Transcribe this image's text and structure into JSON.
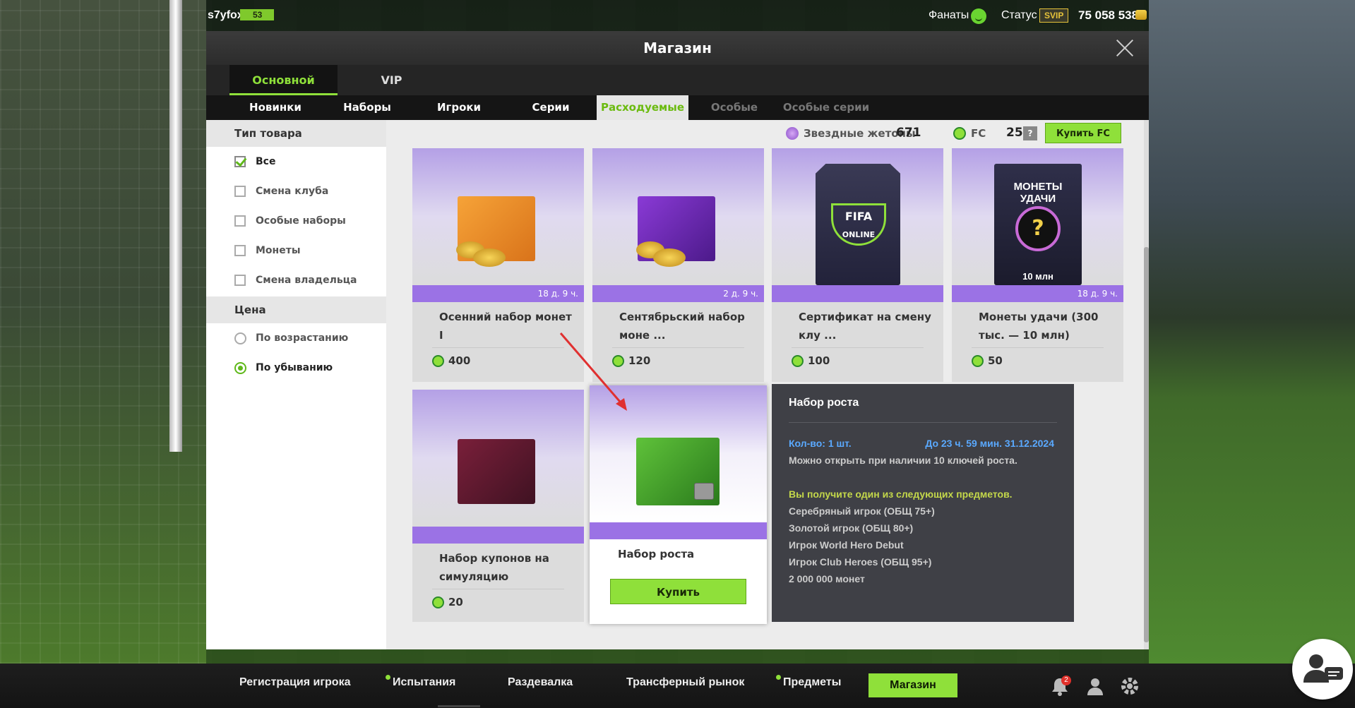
{
  "topbar": {
    "username": "s7yfox",
    "level": "53",
    "fans_label": "Фанаты",
    "status_label": "Статус",
    "status_badge": "SVIP",
    "money": "75 058 538"
  },
  "window": {
    "title": "Магазин"
  },
  "tabs": [
    {
      "label": "Основной",
      "active": true
    },
    {
      "label": "VIP",
      "active": false
    }
  ],
  "subtabs": [
    {
      "label": "Новинки"
    },
    {
      "label": "Наборы"
    },
    {
      "label": "Игроки"
    },
    {
      "label": "Серии"
    },
    {
      "label": "Расходуемые предметы"
    },
    {
      "label": "Особые товары"
    },
    {
      "label": "Особые серии"
    }
  ],
  "sidebar": {
    "type_heading": "Тип товара",
    "type_items": [
      {
        "label": "Все",
        "checked": true
      },
      {
        "label": "Смена клуба",
        "checked": false
      },
      {
        "label": "Особые наборы",
        "checked": false
      },
      {
        "label": "Монеты",
        "checked": false
      },
      {
        "label": "Смена владельца",
        "checked": false
      }
    ],
    "price_heading": "Цена",
    "price_items": [
      {
        "label": "По возрастанию",
        "selected": false
      },
      {
        "label": "По убыванию",
        "selected": true
      }
    ]
  },
  "currency": {
    "star_label": "Звездные жетоны",
    "star_value": "671",
    "fc_label": "FC",
    "fc_value": "25",
    "help": "?",
    "buy_fc": "Купить FC"
  },
  "cards": [
    {
      "title": "Осенний набор монет I",
      "timer": "18 д. 9 ч.",
      "price": "400"
    },
    {
      "title": "Сентябрьский набор моне ...",
      "timer": "2 д. 9 ч.",
      "price": "120"
    },
    {
      "title": "Сертификат на смену клу ...",
      "timer": "",
      "price": "100"
    },
    {
      "title": "Монеты удачи (300 тыс. — 10 млн)",
      "timer": "18 д. 9 ч.",
      "price": "50",
      "image_text": "МОНЕТЫ УДАЧИ",
      "image_sub": "10 млн"
    },
    {
      "title": "Набор купонов на симуляцию",
      "timer": "",
      "price": "20"
    },
    {
      "title": "Набор роста",
      "timer": "",
      "buy": "Купить"
    }
  ],
  "cert_logo": {
    "line1": "FIFA",
    "line2": "ONLINE"
  },
  "tooltip": {
    "title": "Набор роста",
    "qty": "Кол-во: 1 шт.",
    "time": "До 23 ч. 59 мин. 31.12.2024",
    "note": "Можно открыть при наличии 10 ключей роста.",
    "receive": "Вы получите один из следующих предметов.",
    "items": [
      "Серебряный игрок (ОБЩ 75+)",
      "Золотой игрок (ОБЩ 80+)",
      "Игрок World Hero Debut",
      "Игрок Club Heroes (ОБЩ 95+)",
      "2 000 000 монет"
    ]
  },
  "bottom_nav": {
    "items": [
      {
        "label": "Регистрация игрока",
        "dot": false
      },
      {
        "label": "Испытания",
        "dot": true
      },
      {
        "label": "Раздевалка",
        "dot": false
      },
      {
        "label": "Трансферный рынок",
        "dot": false
      },
      {
        "label": "Предметы",
        "dot": true
      }
    ],
    "active": "Магазин",
    "notifications": "2"
  },
  "colors": {
    "accent_green": "#8fe03a",
    "card_purple": "#9b72e5",
    "tooltip_bg": "#3f4046",
    "tooltip_blue": "#5aa9ff",
    "tooltip_yellow": "#c4d84a"
  }
}
